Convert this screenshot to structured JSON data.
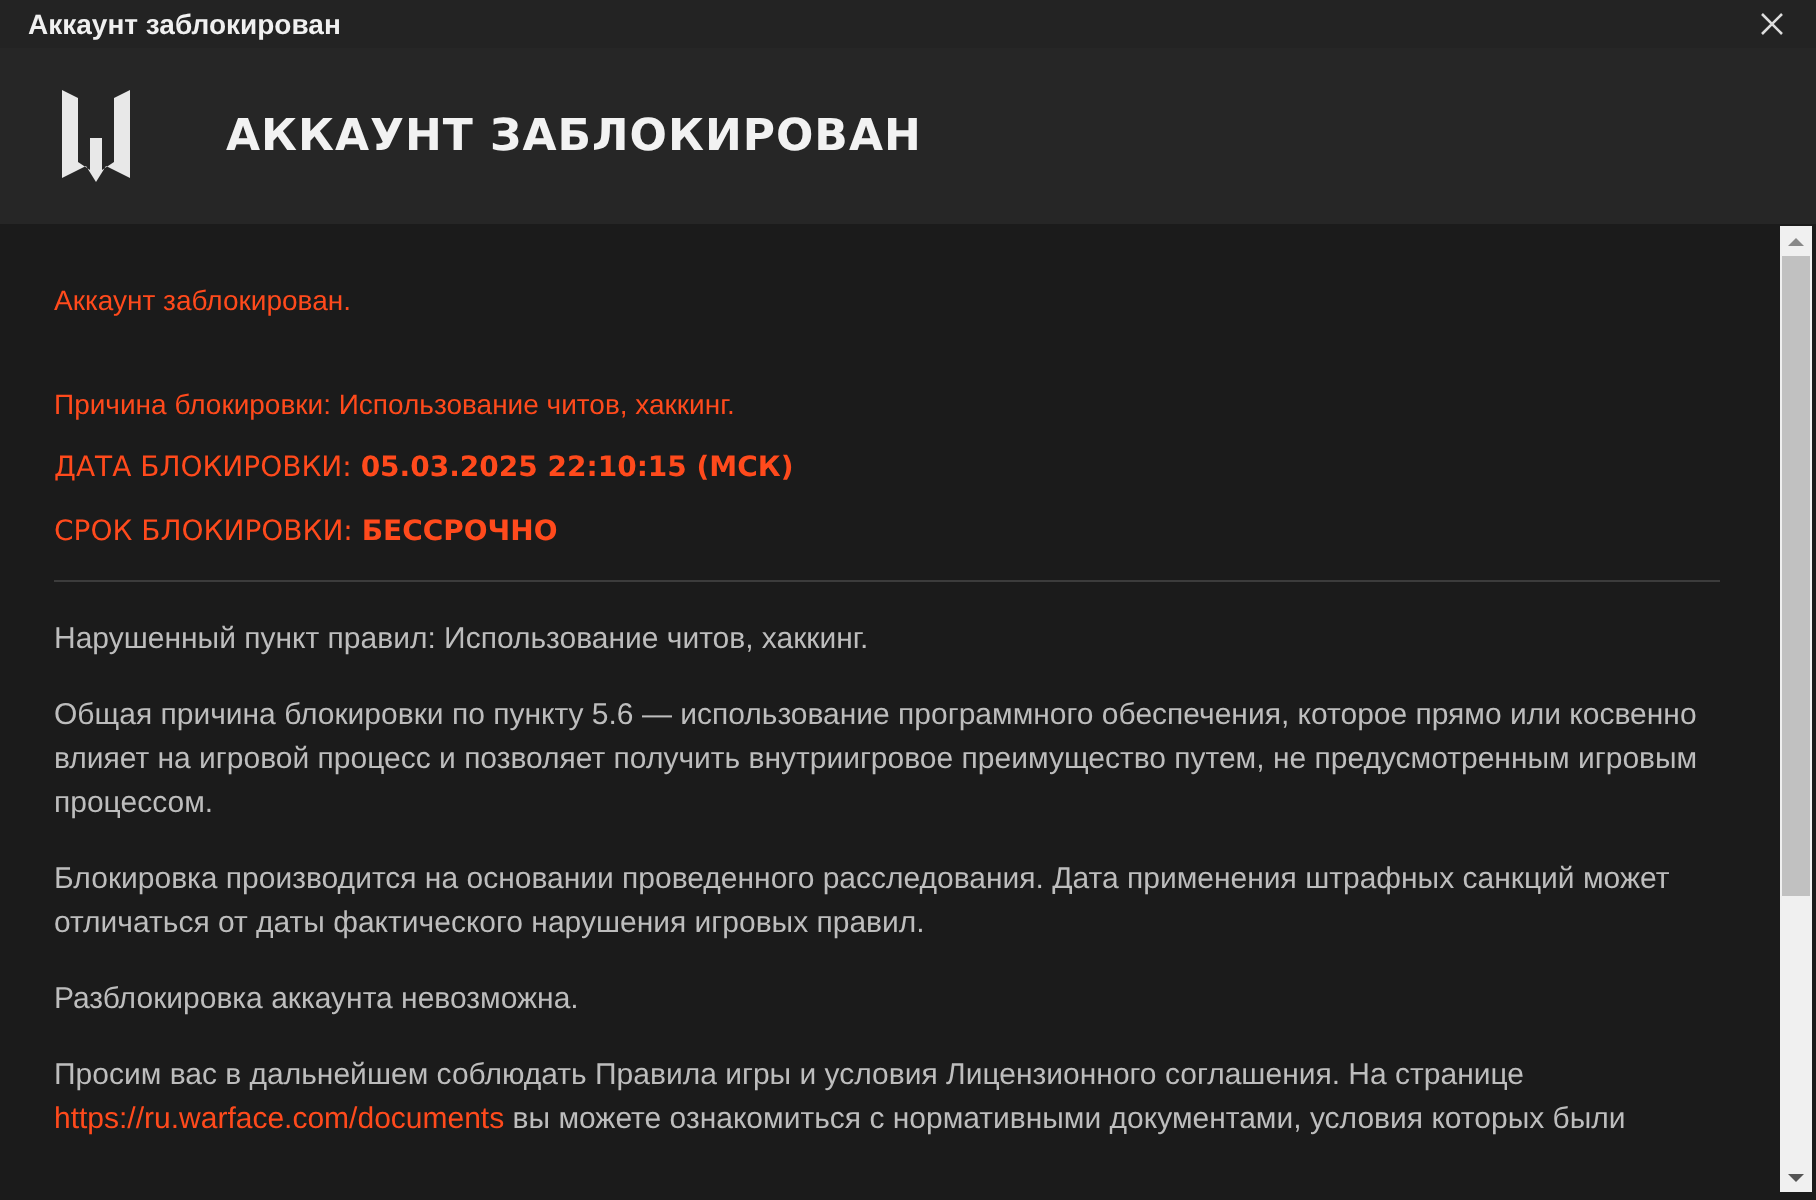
{
  "window": {
    "title": "Аккаунт заблокирован"
  },
  "header": {
    "title": "АККАУНТ ЗАБЛОКИРОВАН"
  },
  "notice": {
    "status": "Аккаунт заблокирован.",
    "reason": "Причина блокировки: Использование читов, хаккинг.",
    "date": "ДАТА БЛОКИРОВКИ: **05.03.2025 22:10:15 (МСК)**",
    "term": "СРОК БЛОКИРОВКИ: **БЕССРОЧНО**"
  },
  "paragraphs": [
    {
      "kind": "text",
      "text": "Нарушенный пункт правил: Использование читов, хаккинг."
    },
    {
      "kind": "text",
      "text": "Общая причина блокировки по пункту 5.6 — использование программного обеспечения, которое прямо или косвенно влияет на игровой процесс и позволяет получить внутриигровое преимущество путем, не предусмотренным игровым процессом."
    },
    {
      "kind": "text",
      "text": "Блокировка производится на основании проведенного расследования. Дата применения штрафных санкций может отличаться от даты фактического нарушения игровых правил."
    },
    {
      "kind": "text",
      "text": "Разблокировка аккаунта невозможна."
    },
    {
      "kind": "link",
      "before": "Просим вас в дальнейшем соблюдать Правила игры и условия Лицензионного соглашения. На странице",
      "link": "https://ru.warface.com/documents",
      "after": "вы можете ознакомиться с нормативными документами, условия которых были"
    }
  ]
}
